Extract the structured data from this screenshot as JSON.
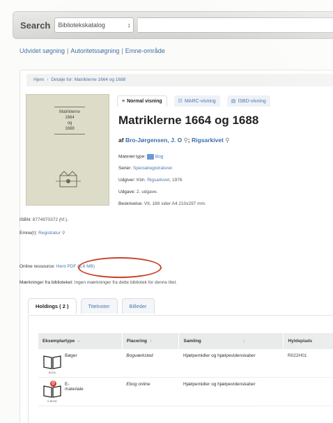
{
  "search": {
    "label": "Search",
    "select_value": "Bibliotekskatalog",
    "select_arrow": "↕"
  },
  "links": {
    "advanced": "Udvidet søgning",
    "authority": "Autoritetssøgning",
    "subject": "Emne-område"
  },
  "breadcrumb": {
    "home": "Hjem",
    "current": "Detalje for: Matriklerne 1664 og 1688"
  },
  "cover": {
    "line1": "Matriklerne",
    "line2": "1664",
    "line3": "og",
    "line4": "1688"
  },
  "view_tabs": [
    {
      "label": "Normal visning",
      "icon": "list-icon",
      "active": true
    },
    {
      "label": "MARC-visning",
      "icon": "grid-icon",
      "active": false
    },
    {
      "label": "ISBD-visning",
      "icon": "isbd-icon",
      "active": false
    }
  ],
  "record": {
    "title": "Matriklerne 1664 og 1688",
    "by": "af",
    "author1": "Bro-Jørgensen, J. O",
    "author2": "Rigsarkivet",
    "author_sep": ";",
    "material_label": "Materiel type:",
    "material_value": "Bog",
    "series_label": "Serier:",
    "series_value": "Specialregistraturer.",
    "publisher_label": "Udgiver:",
    "publisher_pre": "Kbh.",
    "publisher_link": "Rigsarkivet",
    "publisher_year": ", 1976",
    "edition_label": "Udgave:",
    "edition_value": "2. udgave.",
    "description_label": "Beskrivelse:",
    "description_value": "VII, 189 sider A4 210x297 mm.",
    "isbn_label": "ISBN:",
    "isbn_value": "8774970372 (hf.).",
    "subject_label": "Emne(r):",
    "subject_value": "Registratur",
    "online_label": "Online ressource:",
    "online_link": "Hent PDF (5,6 MB)",
    "notes_label": "Mærkninger fra biblioteket:",
    "notes_value": "Ingen mærkninger fra dette bibliotek for denne titel."
  },
  "holding_tabs": [
    {
      "label": "Holdings ( 2 )",
      "active": true
    },
    {
      "label": "Titelnoter",
      "active": false
    },
    {
      "label": "Billeder",
      "active": false
    }
  ],
  "table": {
    "headers": [
      "Eksemplartype",
      "Placering",
      "Samling",
      "Hyldeplads"
    ],
    "header_arrows": [
      "–",
      "↕",
      "↕"
    ],
    "rows": [
      {
        "type": "Bøger",
        "icon_caption": "BOOK",
        "location": "Bogværksted",
        "collection": "Hjælpemidler og hjælpevidenskaber",
        "shelf": "R022H01"
      },
      {
        "type": "E-materiale",
        "icon_caption": "E-BOOK",
        "location": "Ebog online",
        "collection": "Hjælpemidler og hjælpevidenskaber",
        "shelf": ""
      }
    ]
  },
  "colors": {
    "link": "#3a6fa8",
    "highlight": "#c9412a"
  }
}
